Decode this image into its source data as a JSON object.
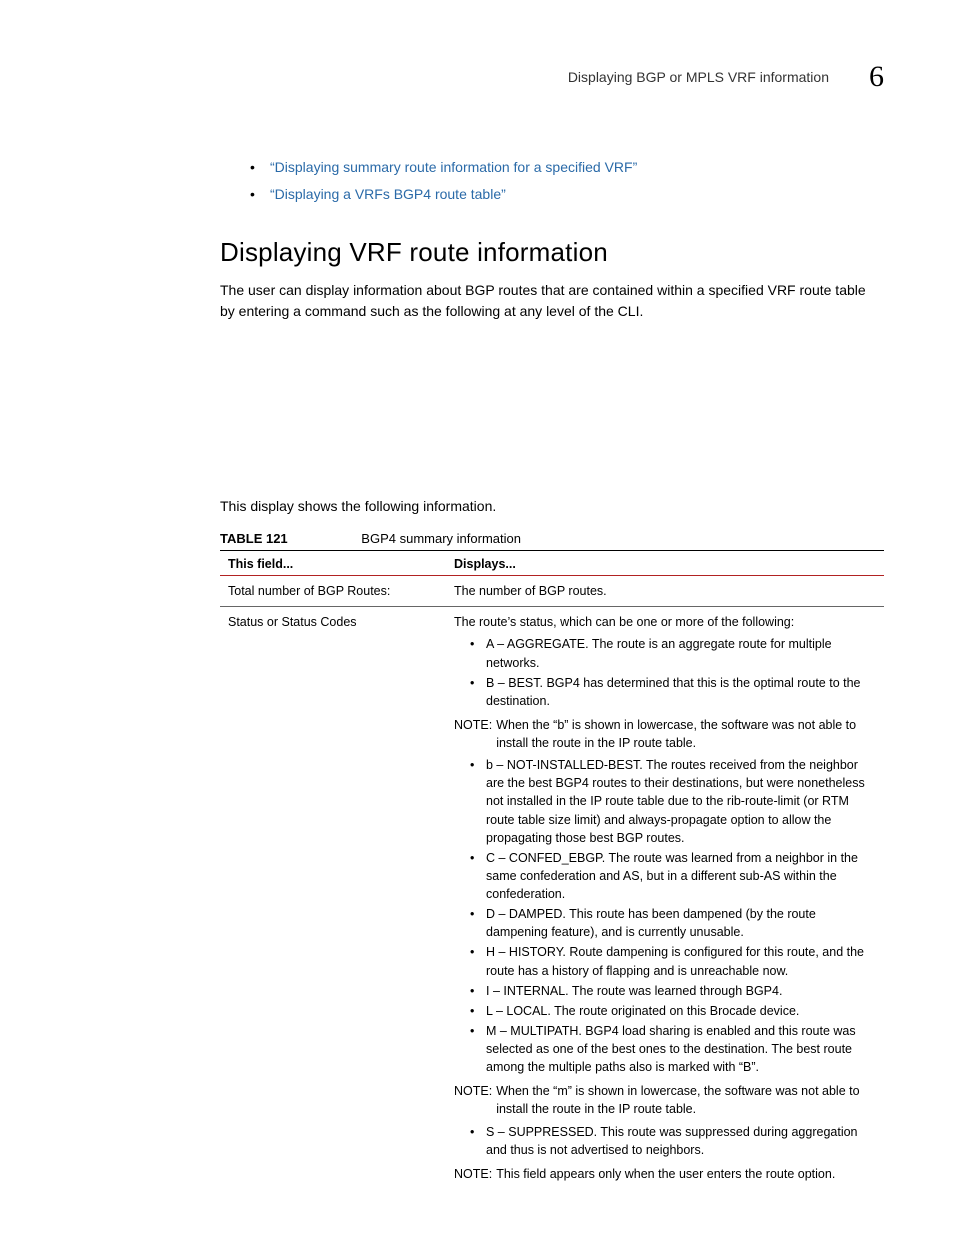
{
  "header": {
    "title": "Displaying BGP or MPLS VRF information",
    "chapter": "6"
  },
  "top_links": [
    "“Displaying summary route information for a specified VRF”",
    "“Displaying a VRFs BGP4 route table”"
  ],
  "section": {
    "heading": "Displaying VRF route information",
    "intro": "The user can display information about BGP routes that are contained within a specified VRF route table by entering a command such as the following at any level of the CLI.",
    "lead_in": "This display shows the following information."
  },
  "table": {
    "label": "TABLE 121",
    "title": "BGP4 summary information",
    "head_field": "This field...",
    "head_displays": "Displays...",
    "rows": [
      {
        "field": "Total number of BGP Routes:",
        "displays_text": "The number of BGP routes."
      },
      {
        "field": "Status or Status Codes",
        "intro": "The route’s status, which can be one or more of the following:",
        "codes1": [
          "A – AGGREGATE. The route is an aggregate route for multiple networks.",
          "B – BEST. BGP4 has determined that this is the optimal route to the destination."
        ],
        "note1_label": "NOTE:",
        "note1_text": "When the “b” is shown in lowercase, the software was not able to install the route in the IP route table.",
        "codes2": [
          "b – NOT-INSTALLED-BEST. The routes received from the neighbor are the best BGP4 routes to their destinations, but were nonetheless not installed in the IP route table due to the rib-route-limit (or RTM route table size limit) and always-propagate option to allow the propagating those best BGP routes.",
          "C – CONFED_EBGP. The route was learned from a neighbor in the same confederation and AS, but in a different sub-AS within the confederation.",
          "D – DAMPED. This route has been dampened (by the route dampening feature), and is currently unusable.",
          "H – HISTORY. Route dampening is configured for this route, and the route has a history of flapping and is unreachable now.",
          "I – INTERNAL. The route was learned through BGP4.",
          "L – LOCAL. The route originated on this Brocade device.",
          "M – MULTIPATH. BGP4 load sharing is enabled and this route was selected as one of the best ones to the destination. The best route among the multiple paths also is marked with “B”."
        ],
        "note2_label": "NOTE:",
        "note2_text": "When the “m” is shown in lowercase, the software was not able to install the route in the IP route table.",
        "codes3": [
          "S – SUPPRESSED. This route was suppressed during aggregation and thus is not advertised to neighbors."
        ],
        "note3_label": "NOTE:",
        "note3_text": "This field appears only when the user enters the route option."
      }
    ]
  }
}
